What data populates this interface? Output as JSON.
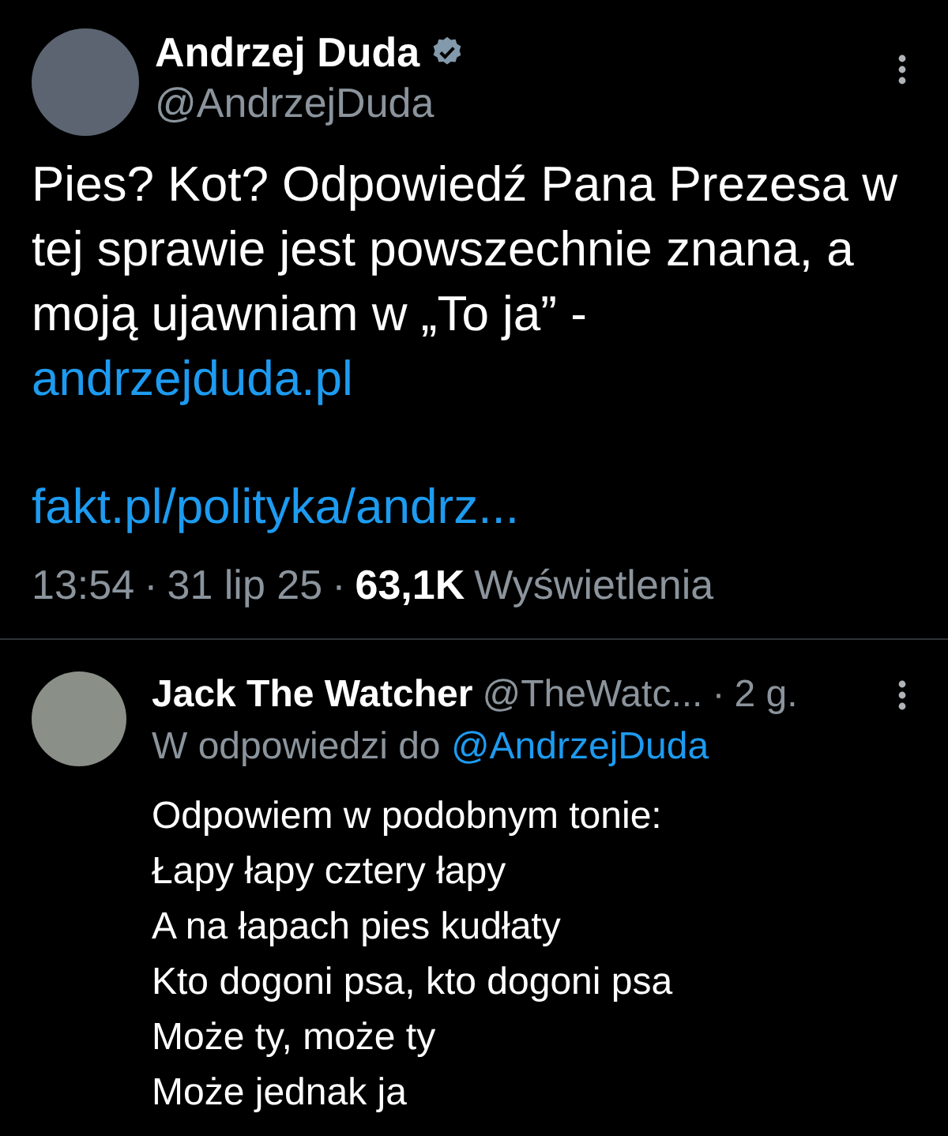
{
  "tweet": {
    "author": {
      "name": "Andrzej Duda",
      "handle": "@AndrzejDuda",
      "verified": true
    },
    "text": "Pies? Kot? Odpowiedź Pana Prezesa w tej sprawie jest powszechnie znana, a moją ujawniam w „To ja” -",
    "text_link": "andrzejduda.pl",
    "card_link": "fakt.pl/polityka/andrz...",
    "meta": {
      "time": "13:54",
      "separator": "·",
      "date": "31 lip 25",
      "views": "63,1K",
      "views_label": "Wyświetlenia"
    }
  },
  "reply": {
    "author": {
      "name": "Jack The Watcher",
      "handle": "@TheWatc..."
    },
    "separator": "·",
    "age": "2 g.",
    "reply_to_label": "W odpowiedzi do",
    "reply_to": "@AndrzejDuda",
    "lines": [
      "Odpowiem w podobnym tonie:",
      "Łapy łapy cztery łapy",
      "A na łapach pies kudłaty",
      "Kto dogoni psa, kto dogoni psa",
      "Może ty, może ty",
      "Może jednak ja"
    ]
  }
}
